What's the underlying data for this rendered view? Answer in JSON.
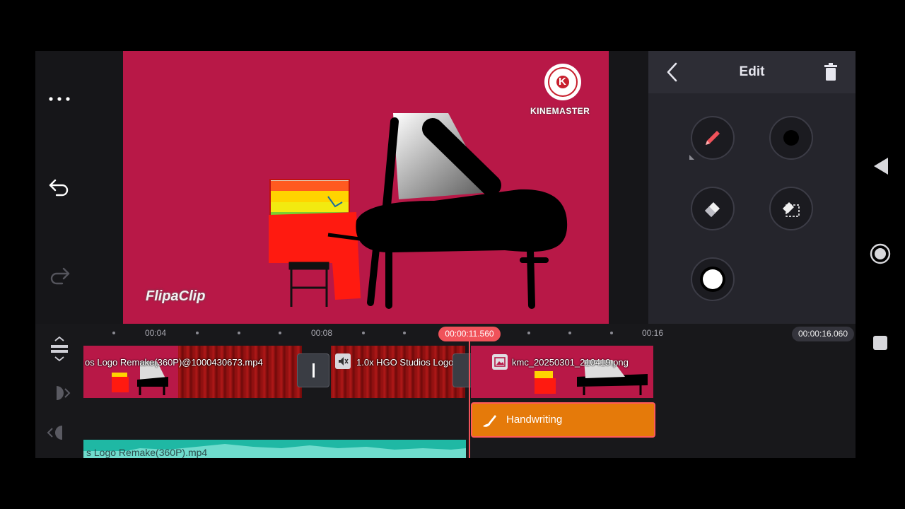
{
  "left_rail": {
    "more_icon": "more-dots-icon",
    "undo_icon": "undo-icon",
    "redo_icon": "redo-icon"
  },
  "preview": {
    "watermark_text": "KINEMASTER",
    "logo_letter": "K",
    "flipaclip_text": "FlipaClip",
    "background_color": "#b81847"
  },
  "edit_panel": {
    "title": "Edit",
    "back_icon": "chevron-left-icon",
    "delete_icon": "trash-icon",
    "tools": [
      "pen-icon",
      "brush-size-icon",
      "eraser-icon",
      "area-eraser-icon",
      "color-icon"
    ]
  },
  "timeline": {
    "ticks": [
      "00:04",
      "00:08",
      "00:16"
    ],
    "playhead_time": "00:00:11.560",
    "total_time": "00:00:16.060",
    "clips": [
      {
        "label": "os Logo Remake(360P)@1000430673.mp4"
      },
      {
        "label": "1.0x HGO Studios Logo"
      },
      {
        "label": "kmc_20250301_210419.png"
      }
    ],
    "handwriting_label": "Handwriting",
    "audio_label": "s Logo Remake(360P).mp4",
    "accent_color": "#f0525a",
    "layer_color": "#e57a0a",
    "audio_color": "#1fb8a4"
  }
}
